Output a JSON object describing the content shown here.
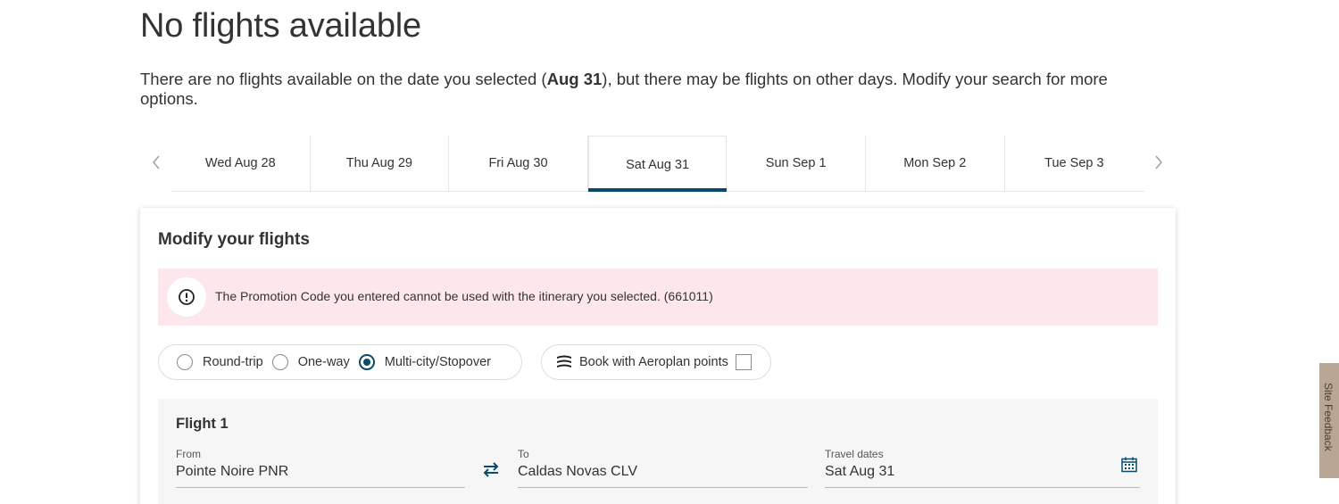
{
  "heading": {
    "title": "No flights available"
  },
  "intro": {
    "text_before": "There are no flights available on the date you selected (",
    "selected_date": "Aug 31",
    "text_after": "), but there may be flights on other days. Modify your search for more options."
  },
  "date_strip": {
    "prev_icon": "chevron-left-icon",
    "next_icon": "chevron-right-icon",
    "tabs": [
      {
        "label": "Wed Aug 28",
        "selected": false
      },
      {
        "label": "Thu Aug 29",
        "selected": false
      },
      {
        "label": "Fri Aug 30",
        "selected": false
      },
      {
        "label": "Sat Aug 31",
        "selected": true
      },
      {
        "label": "Sun Sep 1",
        "selected": false
      },
      {
        "label": "Mon Sep 2",
        "selected": false
      },
      {
        "label": "Tue Sep 3",
        "selected": false
      }
    ]
  },
  "modify": {
    "title": "Modify your flights",
    "alert": {
      "icon": "exclamation-circle-icon",
      "message": "The Promotion Code you entered cannot be used with the itinerary you selected. (661011)",
      "background": "#fde7ec"
    },
    "trip_types": [
      {
        "label": "Round-trip",
        "checked": false
      },
      {
        "label": "One-way",
        "checked": false
      },
      {
        "label": "Multi-city/Stopover",
        "checked": true
      }
    ],
    "aeroplan": {
      "icon": "aeroplan-logo-icon",
      "label": "Book with Aeroplan points",
      "checked": false
    },
    "flight": {
      "label": "Flight 1",
      "from": {
        "label": "From",
        "value": "Pointe Noire PNR"
      },
      "to": {
        "label": "To",
        "value": "Caldas Novas CLV"
      },
      "dates": {
        "label": "Travel dates",
        "value": "Sat Aug 31"
      },
      "swap_icon": "swap-arrows-icon",
      "calendar_icon": "calendar-icon"
    }
  },
  "feedback": {
    "label": "Site Feedback"
  },
  "colors": {
    "accent": "#0b4a6b",
    "alert_bg": "#fde7ec",
    "panel_bg": "#f6f6f6",
    "feedback_bg": "#b9a695"
  }
}
